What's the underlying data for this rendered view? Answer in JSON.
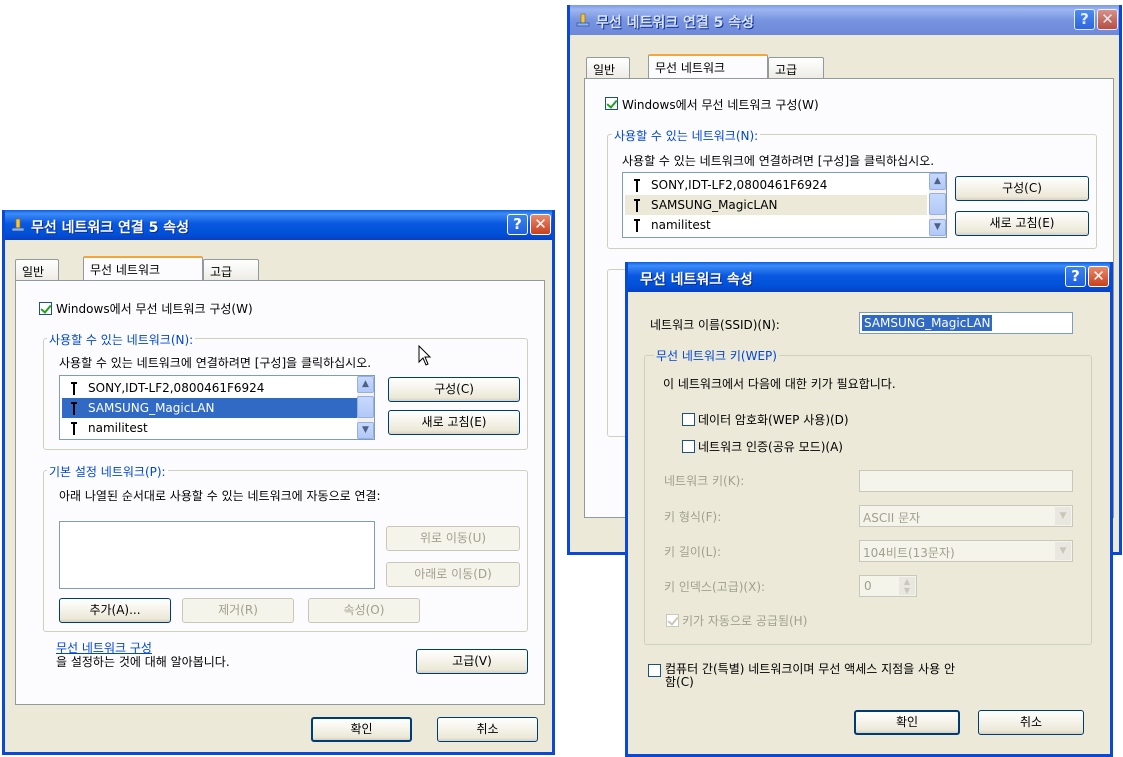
{
  "window_left": {
    "title": "무선 네트워크 연결 5 속성",
    "tabs": [
      "일반",
      "무선 네트워크",
      "고급"
    ],
    "use_windows_checkbox": "Windows에서 무선 네트워크 구성(W)",
    "available_group_label": "사용할 수 있는 네트워크(N):",
    "available_desc": "사용할 수 있는 네트워크에 연결하려면 [구성]을 클릭하십시오.",
    "networks": [
      "SONY,IDT-LF2,0800461F6924",
      "SAMSUNG_MagicLAN",
      "namilitest"
    ],
    "configure_button": "구성(C)",
    "refresh_button": "새로 고침(E)",
    "preferred_group_label": "기본 설정 네트워크(P):",
    "preferred_desc": "아래 나열된 순서대로 사용할 수 있는 네트워크에 자동으로 연결:",
    "move_up_button": "위로 이동(U)",
    "move_down_button": "아래로 이동(D)",
    "add_button": "추가(A)...",
    "remove_button": "제거(R)",
    "properties_button": "속성(O)",
    "learn_link": "무선 네트워크 구성",
    "learn_text": "을 설정하는 것에 대해 알아봅니다.",
    "advanced_button": "고급(V)",
    "ok_button": "확인",
    "cancel_button": "취소"
  },
  "window_right": {
    "title": "무선 네트워크 연결 5 속성",
    "tabs": [
      "일반",
      "무선 네트워크",
      "고급"
    ],
    "use_windows_checkbox": "Windows에서 무선 네트워크 구성(W)",
    "available_group_label": "사용할 수 있는 네트워크(N):",
    "available_desc": "사용할 수 있는 네트워크에 연결하려면 [구성]을 클릭하십시오.",
    "networks": [
      "SONY,IDT-LF2,0800461F6924",
      "SAMSUNG_MagicLAN",
      "namilitest"
    ],
    "configure_button": "구성(C)",
    "refresh_button": "새로 고침(E)"
  },
  "dialog": {
    "title": "무선 네트워크 속성",
    "ssid_label": "네트워크 이름(SSID)(N):",
    "ssid_value": "SAMSUNG_MagicLAN",
    "wep_group_label": "무선 네트워크 키(WEP)",
    "wep_desc": "이 네트워크에서 다음에 대한 키가 필요합니다.",
    "data_encryption": "데이터 암호화(WEP 사용)(D)",
    "network_auth": "네트워크 인증(공유 모드)(A)",
    "key_label": "네트워크 키(K):",
    "key_format_label": "키 형식(F):",
    "key_format_value": "ASCII 문자",
    "key_length_label": "키 길이(L):",
    "key_length_value": "104비트(13문자)",
    "key_index_label": "키 인덱스(고급)(X):",
    "key_index_value": "0",
    "auto_key": "키가 자동으로 공급됨(H)",
    "adhoc_line1": "컴퓨터 간(특별) 네트워크이며 무선 액세스 지점을 사용 안",
    "adhoc_line2": "함(C)",
    "ok_button": "확인",
    "cancel_button": "취소"
  }
}
